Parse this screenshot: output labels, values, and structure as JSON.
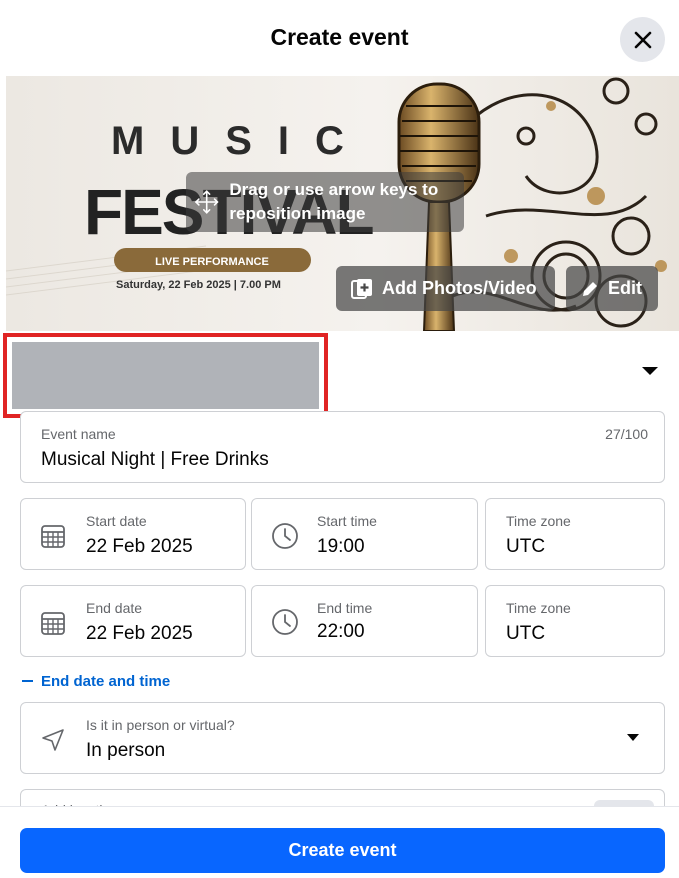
{
  "header": {
    "title": "Create event"
  },
  "cover": {
    "art_line_1": "MUSIC",
    "art_line_2": "FESTIVAL",
    "art_badge": "LIVE PERFORMANCE",
    "art_date": "Saturday, 22 Feb 2025 | 7.00 PM",
    "drag_hint": "Drag or use arrow keys to reposition image",
    "add_media_label": "Add Photos/Video",
    "edit_label": "Edit"
  },
  "form": {
    "event_name": {
      "label": "Event name",
      "value": "Musical Night | Free Drinks",
      "counter": "27/100"
    },
    "start_date": {
      "label": "Start date",
      "value": "22 Feb 2025"
    },
    "start_time": {
      "label": "Start time",
      "value": "19:00"
    },
    "start_timezone": {
      "label": "Time zone",
      "value": "UTC"
    },
    "end_date": {
      "label": "End date",
      "value": "22 Feb 2025"
    },
    "end_time": {
      "label": "End time",
      "value": "22:00"
    },
    "end_timezone": {
      "label": "Time zone",
      "value": "UTC"
    },
    "toggle_end_label": "End date and time",
    "location_type": {
      "label": "Is it in person or virtual?",
      "value": "In person"
    },
    "next_field_label": "Add location"
  },
  "footer": {
    "create_label": "Create event"
  },
  "colors": {
    "primary": "#0866ff",
    "link": "#0064d1",
    "border": "#ced0d4",
    "muted_text": "#65676b",
    "redaction_border": "#e02424"
  }
}
